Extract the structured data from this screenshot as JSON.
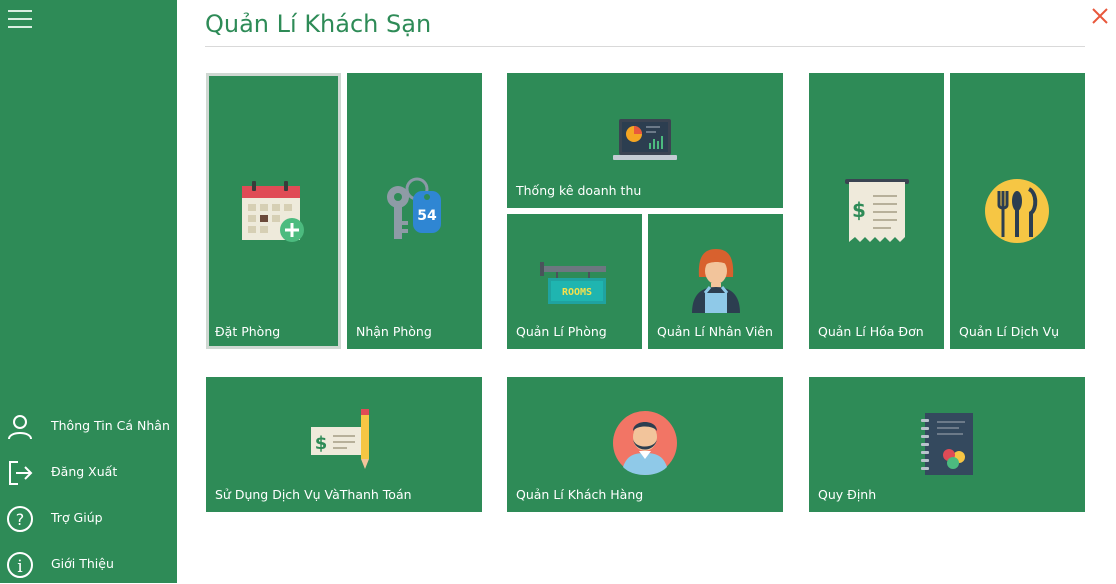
{
  "header": {
    "title": "Quản Lí Khách Sạn"
  },
  "sidebar": {
    "items": [
      {
        "label": "Thông Tin Cá Nhân",
        "icon": "user-icon"
      },
      {
        "label": "Đăng Xuất",
        "icon": "logout-icon"
      },
      {
        "label": "Trợ Giúp",
        "icon": "help-icon"
      },
      {
        "label": "Giới Thiệu",
        "icon": "info-icon"
      }
    ]
  },
  "tiles": {
    "dat_phong": {
      "label": "Đặt Phòng",
      "icon": "calendar-add-icon"
    },
    "nhan_phong": {
      "label": "Nhận Phòng",
      "icon": "room-key-icon"
    },
    "thong_ke": {
      "label": "Thống kê doanh thu",
      "icon": "laptop-chart-icon"
    },
    "quan_li_phong": {
      "label": "Quản Lí Phòng",
      "icon": "rooms-sign-icon"
    },
    "quan_li_nhan_vien": {
      "label": "Quản Lí Nhân Viên",
      "icon": "employee-icon"
    },
    "quan_li_hoa_don": {
      "label": "Quản Lí Hóa Đơn",
      "icon": "receipt-icon"
    },
    "quan_li_dich_vu": {
      "label": "Quản Lí Dịch Vụ",
      "icon": "dining-icon"
    },
    "su_dung_dich_vu": {
      "label": "Sử Dụng Dịch Vụ VàThanh Toán",
      "icon": "cheque-pencil-icon"
    },
    "quan_li_khach_hang": {
      "label": "Quản Lí Khách Hàng",
      "icon": "customer-icon"
    },
    "quy_dinh": {
      "label": "Quy Định",
      "icon": "rulebook-icon"
    }
  },
  "colors": {
    "accent": "#2e8b57",
    "sidebar_bg": "#2e8b57",
    "close": "#e8583c",
    "selected_border": "#cfd8d2"
  }
}
